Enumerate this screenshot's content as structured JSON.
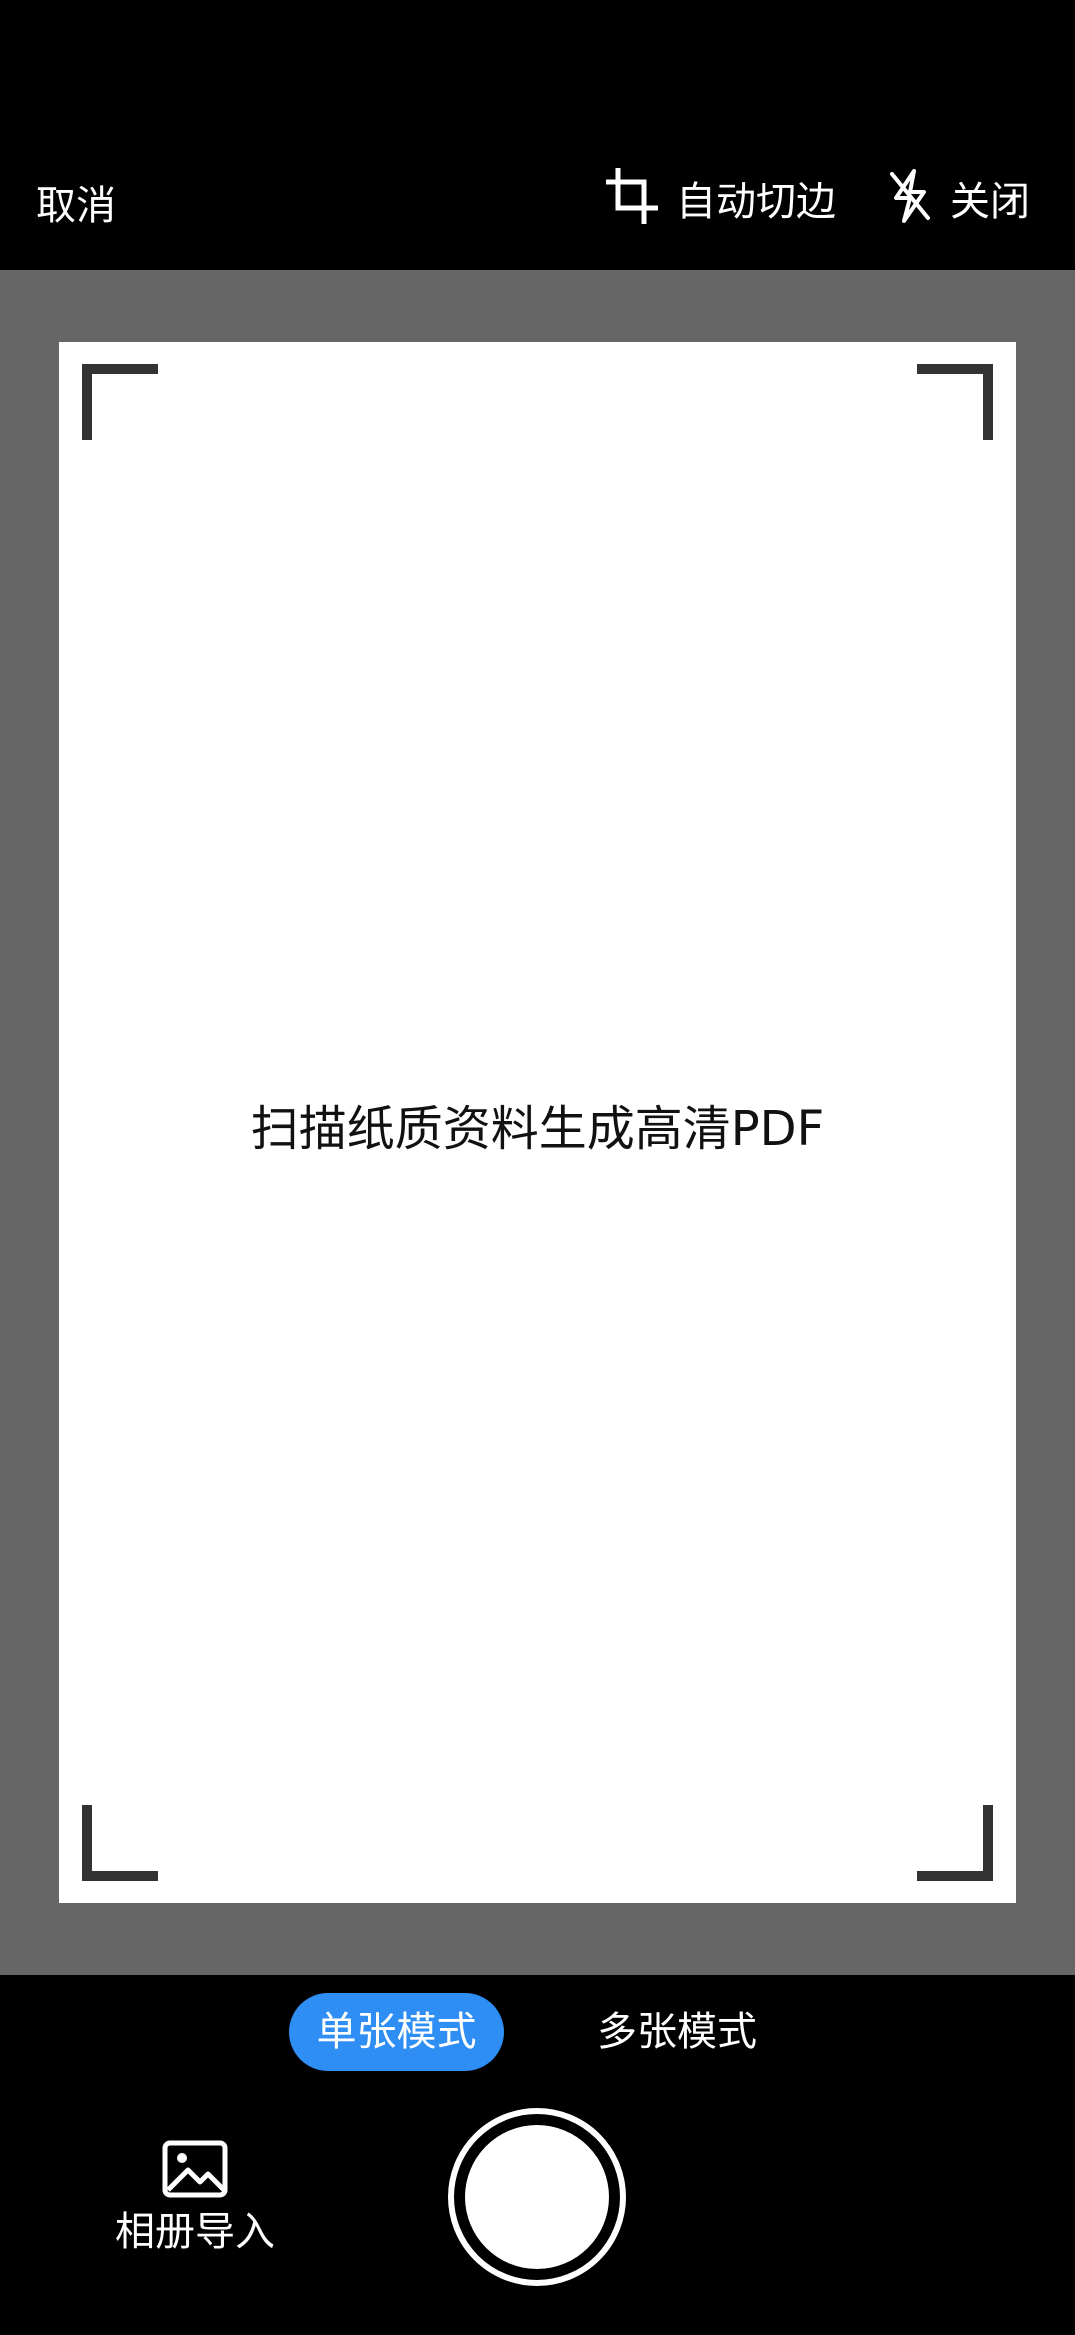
{
  "header": {
    "cancel_label": "取消",
    "auto_crop_label": "自动切边",
    "flash_label": "关闭"
  },
  "viewfinder": {
    "hint_text": "扫描纸质资料生成高清PDF"
  },
  "modes": {
    "single_label": "单张模式",
    "multi_label": "多张模式",
    "selected": "单张模式",
    "accent_color": "#2f8ef3"
  },
  "bottom": {
    "album_label": "相册导入",
    "album_icon": "image-icon",
    "shutter_icon": "shutter-button"
  },
  "icons": {
    "auto_crop": "crop-icon",
    "flash": "flash-off-icon"
  }
}
